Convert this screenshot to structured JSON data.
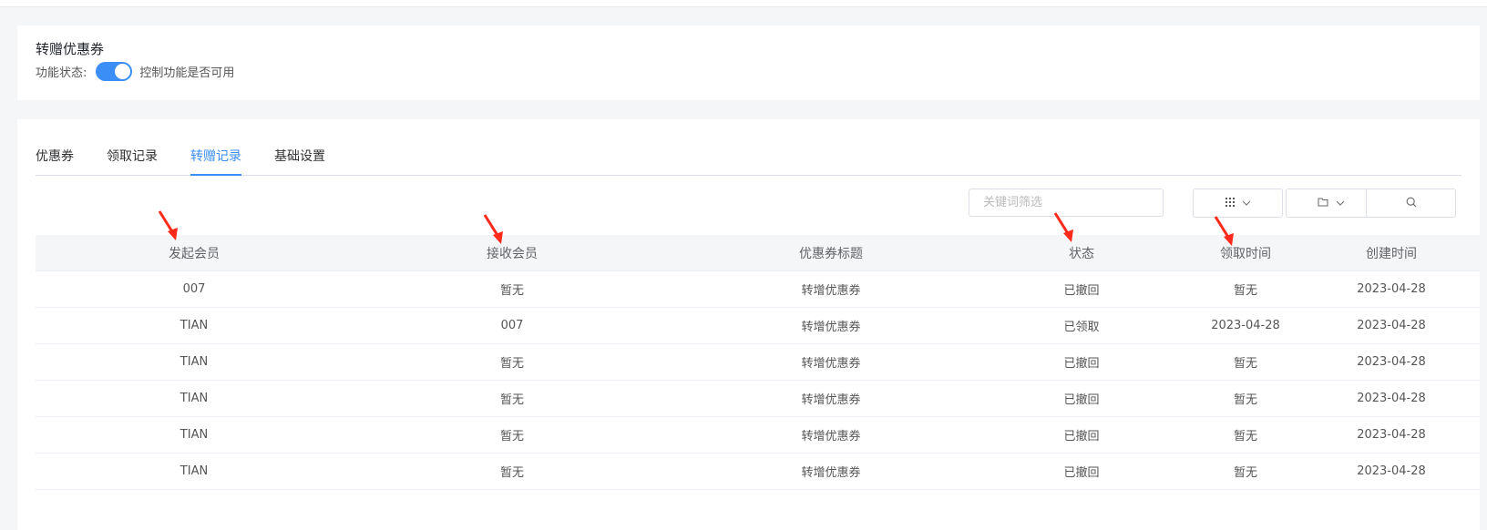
{
  "feature": {
    "title": "转赠优惠券",
    "status_label": "功能状态:",
    "toggle_on": true,
    "hint": "控制功能是否可用"
  },
  "tabs": [
    {
      "label": "优惠券",
      "active": false
    },
    {
      "label": "领取记录",
      "active": false
    },
    {
      "label": "转赠记录",
      "active": true
    },
    {
      "label": "基础设置",
      "active": false
    }
  ],
  "toolbar": {
    "search_placeholder": "关键词筛选",
    "grid_icon": "grid-icon",
    "folder_icon": "folder-icon",
    "search_icon": "search-icon"
  },
  "table": {
    "columns": [
      "发起会员",
      "接收会员",
      "优惠券标题",
      "状态",
      "领取时间",
      "创建时间"
    ],
    "rows": [
      [
        "007",
        "暂无",
        "转增优惠券",
        "已撤回",
        "暂无",
        "2023-04-28"
      ],
      [
        "TIAN",
        "007",
        "转增优惠券",
        "已领取",
        "2023-04-28",
        "2023-04-28"
      ],
      [
        "TIAN",
        "暂无",
        "转增优惠券",
        "已撤回",
        "暂无",
        "2023-04-28"
      ],
      [
        "TIAN",
        "暂无",
        "转增优惠券",
        "已撤回",
        "暂无",
        "2023-04-28"
      ],
      [
        "TIAN",
        "暂无",
        "转增优惠券",
        "已撤回",
        "暂无",
        "2023-04-28"
      ],
      [
        "TIAN",
        "暂无",
        "转增优惠券",
        "已撤回",
        "暂无",
        "2023-04-28"
      ]
    ]
  },
  "colors": {
    "accent": "#3a8ef6",
    "annotation_arrow": "#ff2a1a"
  }
}
